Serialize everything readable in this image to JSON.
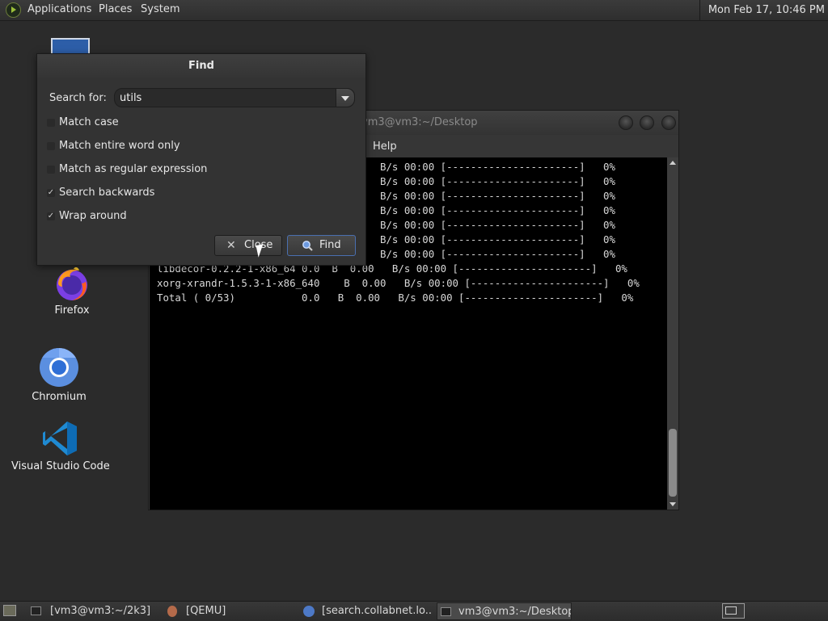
{
  "top_panel": {
    "menus": [
      "Applications",
      "Places",
      "System"
    ],
    "clock": "Mon Feb 17, 10:46 PM"
  },
  "desktop_icons": [
    {
      "label": "Firefox",
      "icon": "firefox-icon"
    },
    {
      "label": "Chromium",
      "icon": "chromium-icon"
    },
    {
      "label": "Visual Studio Code",
      "icon": "vscode-icon"
    }
  ],
  "terminal": {
    "title": "vm3@vm3:~/Desktop",
    "menu_help": "Help",
    "lines": [
      "                             64.00   B/s 00:00 [----------------------]   0%",
      "                              0.00   B/s 00:00 [----------------------]   0%",
      "                              0.00   B/s 00:00 [----------------------]   0%",
      "                             64.00   B/s 00:00 [----------------------]   0%",
      "                              0.00   B/s 00:00 [----------------------]   0%",
      "                              0.00   B/s 00:00 [----------------------]   0%",
      "                              0.00   B/s 00:00 [----------------------]   0%",
      "libdecor-0.2.2-1-x86_64 0.0  B  0.00   B/s 00:00 [----------------------]   0%",
      "xorg-xrandr-1.5.3-1-x86_640    B  0.00   B/s 00:00 [----------------------]   0%",
      "Total ( 0/53)           0.0   B  0.00   B/s 00:00 [----------------------]   0%"
    ]
  },
  "find_dialog": {
    "title": "Find",
    "search_label": "Search for:",
    "search_value": "utils",
    "options": [
      {
        "label": "Match case",
        "checked": false
      },
      {
        "label": "Match entire word only",
        "checked": false
      },
      {
        "label": "Match as regular expression",
        "checked": false
      },
      {
        "label": "Search backwards",
        "checked": true
      },
      {
        "label": "Wrap around",
        "checked": true
      }
    ],
    "close_label": "Close",
    "find_label": "Find"
  },
  "taskbar": {
    "tasks": [
      {
        "label": "[vm3@vm3:~/2k3]",
        "active": false
      },
      {
        "label": "[QEMU]",
        "active": false
      },
      {
        "label": "[search.collabnet.lo...",
        "active": false
      },
      {
        "label": "vm3@vm3:~/Desktop",
        "active": true
      }
    ]
  }
}
